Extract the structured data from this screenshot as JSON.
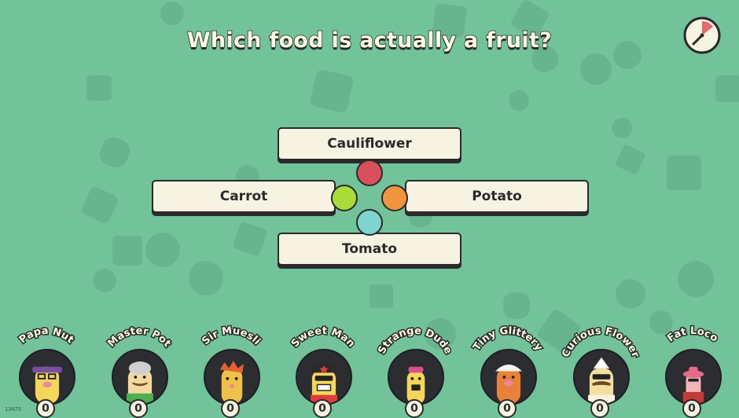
{
  "question": "Which food is actually a fruit?",
  "answers": {
    "top": "Cauliflower",
    "left": "Carrot",
    "right": "Potato",
    "bottom": "Tomato"
  },
  "answer_colors": {
    "top": "#d94f5c",
    "left": "#a9db3a",
    "right": "#f0953d",
    "bottom": "#7fd4cf"
  },
  "timer": {
    "icon": "timer-icon",
    "accent": "#e86a6a"
  },
  "players": [
    {
      "name": "Papa Nut",
      "score": "0"
    },
    {
      "name": "Master Pot",
      "score": "0"
    },
    {
      "name": "Sir Muesli",
      "score": "0"
    },
    {
      "name": "Sweet Man",
      "score": "0"
    },
    {
      "name": "Strange Dude",
      "score": "0"
    },
    {
      "name": "Tiny Glittery",
      "score": "0"
    },
    {
      "name": "Curious Flower",
      "score": "0"
    },
    {
      "name": "Fat Loco",
      "score": "0"
    }
  ],
  "build_number": "13475"
}
